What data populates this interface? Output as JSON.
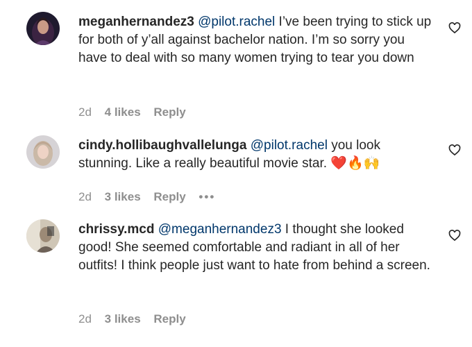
{
  "comments": [
    {
      "username": "meganhernandez3",
      "mention": "@pilot.rachel",
      "text": " I’ve been trying to stick up for both of y’all against bachelor nation. I’m so sorry you have to deal with so many women trying to tear you down",
      "time": "2d",
      "likes": "4 likes",
      "reply": "Reply"
    },
    {
      "username": "cindy.hollibaughvallelunga",
      "mention": "@pilot.rachel",
      "text": " you look stunning. Like a really beautiful movie star. ",
      "emoji": "❤️🔥🙌",
      "time": "2d",
      "likes": "3 likes",
      "reply": "Reply",
      "more": "•••"
    },
    {
      "username": "chrissy.mcd",
      "mention": "@meganhernandez3",
      "text": " I thought she looked good! She seemed comfortable and radiant in all of her outfits! I think people just want to hate from behind a screen.",
      "time": "2d",
      "likes": "3 likes",
      "reply": "Reply"
    }
  ],
  "icons": {
    "like": "heart-outline-icon",
    "options": "more-options-icon"
  },
  "colors": {
    "mention": "#00376b",
    "meta": "#8e8e8e",
    "text": "#262626"
  }
}
